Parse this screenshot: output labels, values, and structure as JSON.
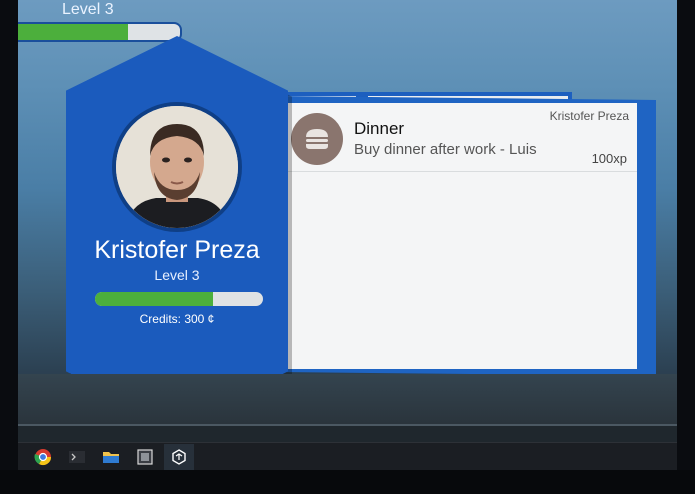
{
  "hud": {
    "level_text": "Level 3",
    "progress": 0.68
  },
  "profile": {
    "name": "Kristofer Preza",
    "level_text": "Level 3",
    "xp_progress": 0.7,
    "credits_text": "Credits: 300 ¢"
  },
  "quests": [
    {
      "icon": "burger-icon",
      "title": "Dinner",
      "description": "Buy dinner after work - Luis",
      "owner": "Kristofer Preza",
      "xp": "100xp"
    }
  ],
  "taskbar": {
    "items": [
      "chrome-icon",
      "terminal-icon",
      "file-explorer-icon",
      "app-icon",
      "unity-icon"
    ],
    "active_index": 4
  },
  "colors": {
    "primary_blue": "#1b5bbd",
    "progress_green": "#4caf3c",
    "card_bg": "#f4f5f6"
  }
}
